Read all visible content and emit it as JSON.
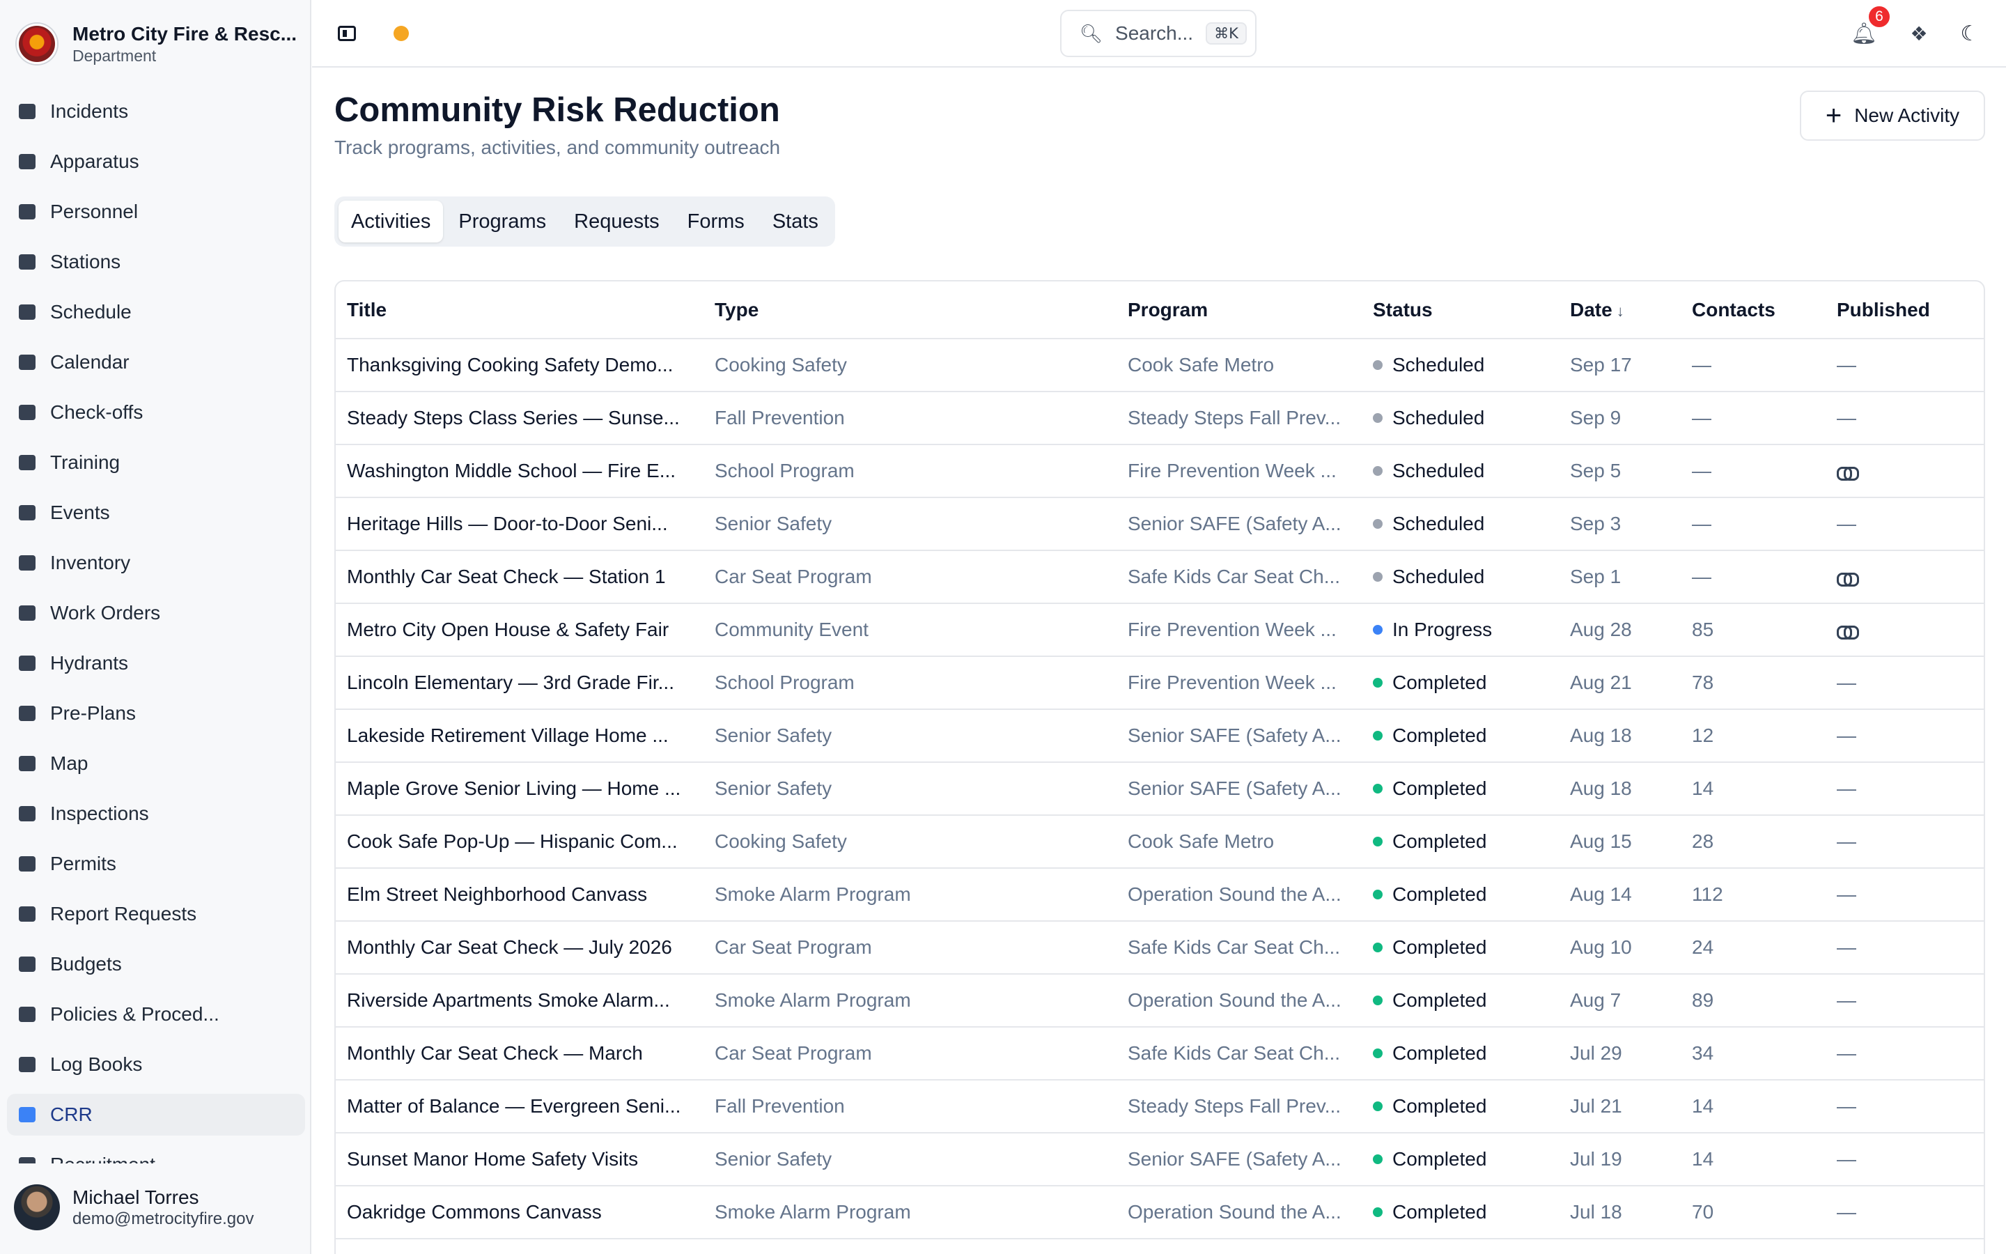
{
  "brand": {
    "name": "Metro City Fire & Resc...",
    "subtitle": "Department"
  },
  "nav": [
    {
      "label": "Incidents",
      "icon": "incidents-icon"
    },
    {
      "label": "Apparatus",
      "icon": "truck-icon"
    },
    {
      "label": "Personnel",
      "icon": "id-card-icon"
    },
    {
      "label": "Stations",
      "icon": "building-icon"
    },
    {
      "label": "Schedule",
      "icon": "calendar-grid-icon"
    },
    {
      "label": "Calendar",
      "icon": "calendar-icon"
    },
    {
      "label": "Check-offs",
      "icon": "clipboard-check-icon"
    },
    {
      "label": "Training",
      "icon": "graduation-cap-icon"
    },
    {
      "label": "Events",
      "icon": "calendar-star-icon"
    },
    {
      "label": "Inventory",
      "icon": "wrench-screwdriver-icon"
    },
    {
      "label": "Work Orders",
      "icon": "wrench-icon"
    },
    {
      "label": "Hydrants",
      "icon": "hydrant-icon"
    },
    {
      "label": "Pre-Plans",
      "icon": "document-icon"
    },
    {
      "label": "Map",
      "icon": "map-icon"
    },
    {
      "label": "Inspections",
      "icon": "clipboard-list-icon"
    },
    {
      "label": "Permits",
      "icon": "permit-icon"
    },
    {
      "label": "Report Requests",
      "icon": "report-icon"
    },
    {
      "label": "Budgets",
      "icon": "piggy-bank-icon"
    },
    {
      "label": "Policies & Proced...",
      "icon": "book-icon"
    },
    {
      "label": "Log Books",
      "icon": "books-icon"
    },
    {
      "label": "CRR",
      "icon": "megaphone-icon",
      "active": true
    },
    {
      "label": "Recruitment",
      "icon": "recruitment-icon"
    }
  ],
  "user": {
    "name": "Michael Torres",
    "email": "demo@metrocityfire.gov"
  },
  "topbar": {
    "search_placeholder": "Search...",
    "search_shortcut": "⌘K",
    "notification_count": "6"
  },
  "page": {
    "title": "Community Risk Reduction",
    "subtitle": "Track programs, activities, and community outreach",
    "new_button": "New Activity"
  },
  "tabs": [
    {
      "label": "Activities",
      "active": true
    },
    {
      "label": "Programs"
    },
    {
      "label": "Requests"
    },
    {
      "label": "Forms"
    },
    {
      "label": "Stats"
    }
  ],
  "colors": {
    "scheduled": "#9ca3af",
    "in_progress": "#3b82f6",
    "completed": "#10b981"
  },
  "table": {
    "columns": [
      "Title",
      "Type",
      "Program",
      "Status",
      "Date",
      "Contacts",
      "Published"
    ],
    "rows": [
      {
        "title": "Thanksgiving Cooking Safety Demo...",
        "type": "Cooking Safety",
        "program": "Cook Safe Metro",
        "status": "Scheduled",
        "date": "Sep 17",
        "contacts": "—",
        "published": "—"
      },
      {
        "title": "Steady Steps Class Series — Sunse...",
        "type": "Fall Prevention",
        "program": "Steady Steps Fall Prev...",
        "status": "Scheduled",
        "date": "Sep 9",
        "contacts": "—",
        "published": "—"
      },
      {
        "title": "Washington Middle School — Fire E...",
        "type": "School Program",
        "program": "Fire Prevention Week ...",
        "status": "Scheduled",
        "date": "Sep 5",
        "contacts": "—",
        "published": "link"
      },
      {
        "title": "Heritage Hills — Door-to-Door Seni...",
        "type": "Senior Safety",
        "program": "Senior SAFE (Safety A...",
        "status": "Scheduled",
        "date": "Sep 3",
        "contacts": "—",
        "published": "—"
      },
      {
        "title": "Monthly Car Seat Check — Station 1",
        "type": "Car Seat Program",
        "program": "Safe Kids Car Seat Ch...",
        "status": "Scheduled",
        "date": "Sep 1",
        "contacts": "—",
        "published": "link"
      },
      {
        "title": "Metro City Open House & Safety Fair",
        "type": "Community Event",
        "program": "Fire Prevention Week ...",
        "status": "In Progress",
        "date": "Aug 28",
        "contacts": "85",
        "published": "link"
      },
      {
        "title": "Lincoln Elementary — 3rd Grade Fir...",
        "type": "School Program",
        "program": "Fire Prevention Week ...",
        "status": "Completed",
        "date": "Aug 21",
        "contacts": "78",
        "published": "—"
      },
      {
        "title": "Lakeside Retirement Village Home ...",
        "type": "Senior Safety",
        "program": "Senior SAFE (Safety A...",
        "status": "Completed",
        "date": "Aug 18",
        "contacts": "12",
        "published": "—"
      },
      {
        "title": "Maple Grove Senior Living — Home ...",
        "type": "Senior Safety",
        "program": "Senior SAFE (Safety A...",
        "status": "Completed",
        "date": "Aug 18",
        "contacts": "14",
        "published": "—"
      },
      {
        "title": "Cook Safe Pop-Up — Hispanic Com...",
        "type": "Cooking Safety",
        "program": "Cook Safe Metro",
        "status": "Completed",
        "date": "Aug 15",
        "contacts": "28",
        "published": "—"
      },
      {
        "title": "Elm Street Neighborhood Canvass",
        "type": "Smoke Alarm Program",
        "program": "Operation Sound the A...",
        "status": "Completed",
        "date": "Aug 14",
        "contacts": "112",
        "published": "—"
      },
      {
        "title": "Monthly Car Seat Check — July 2026",
        "type": "Car Seat Program",
        "program": "Safe Kids Car Seat Ch...",
        "status": "Completed",
        "date": "Aug 10",
        "contacts": "24",
        "published": "—"
      },
      {
        "title": "Riverside Apartments Smoke Alarm...",
        "type": "Smoke Alarm Program",
        "program": "Operation Sound the A...",
        "status": "Completed",
        "date": "Aug 7",
        "contacts": "89",
        "published": "—"
      },
      {
        "title": "Monthly Car Seat Check — March",
        "type": "Car Seat Program",
        "program": "Safe Kids Car Seat Ch...",
        "status": "Completed",
        "date": "Jul 29",
        "contacts": "34",
        "published": "—"
      },
      {
        "title": "Matter of Balance — Evergreen Seni...",
        "type": "Fall Prevention",
        "program": "Steady Steps Fall Prev...",
        "status": "Completed",
        "date": "Jul 21",
        "contacts": "14",
        "published": "—"
      },
      {
        "title": "Sunset Manor Home Safety Visits",
        "type": "Senior Safety",
        "program": "Senior SAFE (Safety A...",
        "status": "Completed",
        "date": "Jul 19",
        "contacts": "14",
        "published": "—"
      },
      {
        "title": "Oakridge Commons Canvass",
        "type": "Smoke Alarm Program",
        "program": "Operation Sound the A...",
        "status": "Completed",
        "date": "Jul 18",
        "contacts": "70",
        "published": "—"
      }
    ]
  }
}
